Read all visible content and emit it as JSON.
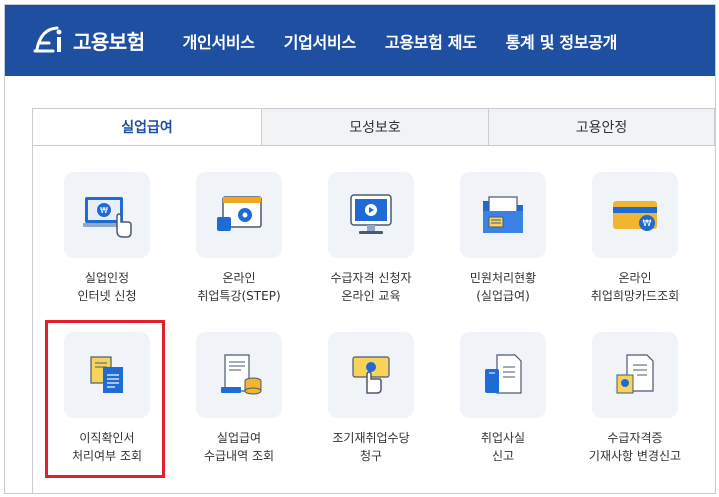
{
  "header": {
    "logo_text": "고용보험",
    "logo_icon": "ei-logo-icon",
    "nav": [
      "개인서비스",
      "기업서비스",
      "고용보험 제도",
      "통계 및 정보공개"
    ]
  },
  "tabs": [
    {
      "label": "실업급여",
      "active": true
    },
    {
      "label": "모성보호",
      "active": false
    },
    {
      "label": "고용안정",
      "active": false
    }
  ],
  "tiles": [
    {
      "icon": "online-computer-touch-icon",
      "line1": "실업인정",
      "line2": "인터넷 신청"
    },
    {
      "icon": "online-lecture-icon",
      "line1": "온라인",
      "line2": "취업특강(STEP)"
    },
    {
      "icon": "monitor-play-icon",
      "line1": "수급자격 신청자",
      "line2": "온라인 교육"
    },
    {
      "icon": "folder-documents-icon",
      "line1": "민원처리현황",
      "line2": "(실업급여)"
    },
    {
      "icon": "credit-card-icon",
      "line1": "온라인",
      "line2": "취업희망카드조회"
    },
    {
      "icon": "documents-copy-icon",
      "line1": "이직확인서",
      "line2": "처리여부 조회"
    },
    {
      "icon": "receipt-coins-icon",
      "line1": "실업급여",
      "line2": "수급내역 조회"
    },
    {
      "icon": "hand-money-icon",
      "line1": "조기재취업수당",
      "line2": "청구"
    },
    {
      "icon": "mobile-document-icon",
      "line1": "취업사실",
      "line2": "신고"
    },
    {
      "icon": "certificate-document-icon",
      "line1": "수급자격증",
      "line2": "기재사항 변경신고"
    }
  ],
  "colors": {
    "header_bg": "#1e4fa1",
    "active_tab_text": "#1e4fa1",
    "highlight_border": "#e0202a",
    "icon_tile_bg": "#f0f3f8"
  }
}
